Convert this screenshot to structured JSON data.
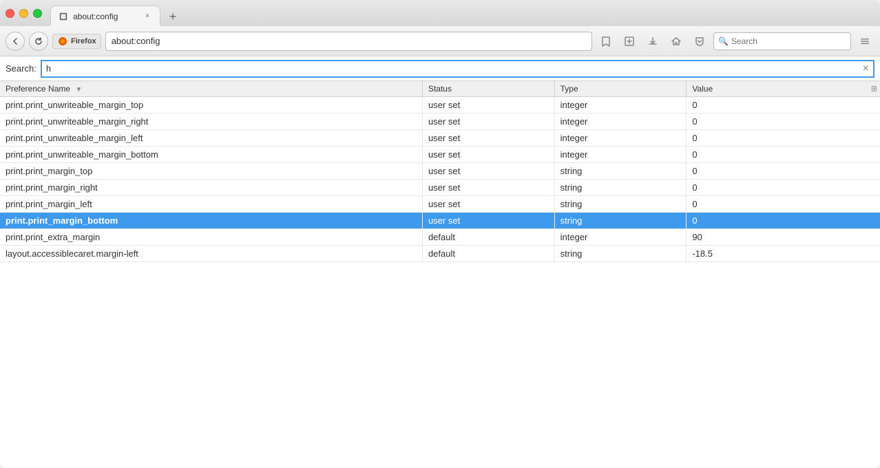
{
  "window": {
    "title": "about:config"
  },
  "titlebar": {
    "tab_title": "about:config",
    "close_label": "×",
    "add_tab_label": "+"
  },
  "toolbar": {
    "firefox_label": "Firefox",
    "url": "about:config",
    "reload_title": "Reload",
    "search_placeholder": "Search"
  },
  "search_bar": {
    "label": "Search:",
    "value": "h",
    "clear_label": "×"
  },
  "table": {
    "columns": [
      {
        "key": "name",
        "label": "Preference Name",
        "has_sort": true
      },
      {
        "key": "status",
        "label": "Status"
      },
      {
        "key": "type",
        "label": "Type"
      },
      {
        "key": "value",
        "label": "Value",
        "has_icon": true
      }
    ],
    "rows": [
      {
        "name": "print.print_unwriteable_margin_top",
        "status": "user set",
        "type": "integer",
        "value": "0",
        "selected": false
      },
      {
        "name": "print.print_unwriteable_margin_right",
        "status": "user set",
        "type": "integer",
        "value": "0",
        "selected": false
      },
      {
        "name": "print.print_unwriteable_margin_left",
        "status": "user set",
        "type": "integer",
        "value": "0",
        "selected": false
      },
      {
        "name": "print.print_unwriteable_margin_bottom",
        "status": "user set",
        "type": "integer",
        "value": "0",
        "selected": false
      },
      {
        "name": "print.print_margin_top",
        "status": "user set",
        "type": "string",
        "value": "0",
        "selected": false
      },
      {
        "name": "print.print_margin_right",
        "status": "user set",
        "type": "string",
        "value": "0",
        "selected": false
      },
      {
        "name": "print.print_margin_left",
        "status": "user set",
        "type": "string",
        "value": "0",
        "selected": false
      },
      {
        "name": "print.print_margin_bottom",
        "status": "user set",
        "type": "string",
        "value": "0",
        "selected": true
      },
      {
        "name": "print.print_extra_margin",
        "status": "default",
        "type": "integer",
        "value": "90",
        "selected": false
      },
      {
        "name": "layout.accessiblecaret.margin-left",
        "status": "default",
        "type": "string",
        "value": "-18.5",
        "selected": false
      }
    ]
  },
  "colors": {
    "selected_bg": "#3d9aed",
    "selected_text": "#ffffff",
    "header_bg": "#f0f0f0",
    "border": "#d0d0d0",
    "url_highlight": "#3d9aed"
  }
}
